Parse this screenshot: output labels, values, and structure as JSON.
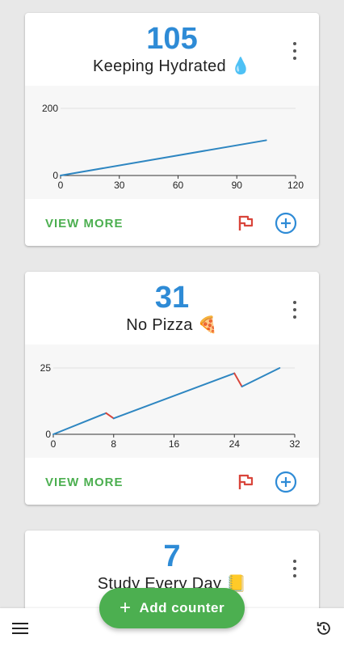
{
  "cards": [
    {
      "count": "105",
      "title": "Keeping Hydrated 💧",
      "view_more": "VIEW MORE",
      "chart_data": {
        "type": "line",
        "x": [
          0,
          105
        ],
        "y": [
          0,
          105
        ],
        "xticks": [
          "0",
          "30",
          "60",
          "90",
          "120"
        ],
        "yticks": [
          "0",
          "200"
        ],
        "xlim": [
          0,
          120
        ],
        "ylim": [
          0,
          200
        ],
        "decreasing_segments": []
      }
    },
    {
      "count": "31",
      "title": "No Pizza 🍕",
      "view_more": "VIEW MORE",
      "chart_data": {
        "type": "line",
        "x": [
          0,
          7,
          8,
          24,
          25,
          30
        ],
        "y": [
          0,
          8,
          6,
          23,
          18,
          25
        ],
        "xticks": [
          "0",
          "8",
          "16",
          "24",
          "32"
        ],
        "yticks": [
          "0",
          "25"
        ],
        "xlim": [
          0,
          32
        ],
        "ylim": [
          0,
          25
        ],
        "decreasing_segments": [
          [
            7,
            8
          ],
          [
            24,
            25
          ]
        ]
      }
    },
    {
      "count": "7",
      "title": "Study Every Day 📒"
    }
  ],
  "colors": {
    "accent_blue": "#2e8bd6",
    "line_up": "#2e86c1",
    "line_down": "#d9453b",
    "green": "#4caf50",
    "flag_red": "#d9453b"
  },
  "fab": {
    "icon": "plus-icon",
    "label": "Add counter"
  },
  "bottom_bar": {
    "left_icon": "menu-icon",
    "right_icon": "history-icon"
  }
}
